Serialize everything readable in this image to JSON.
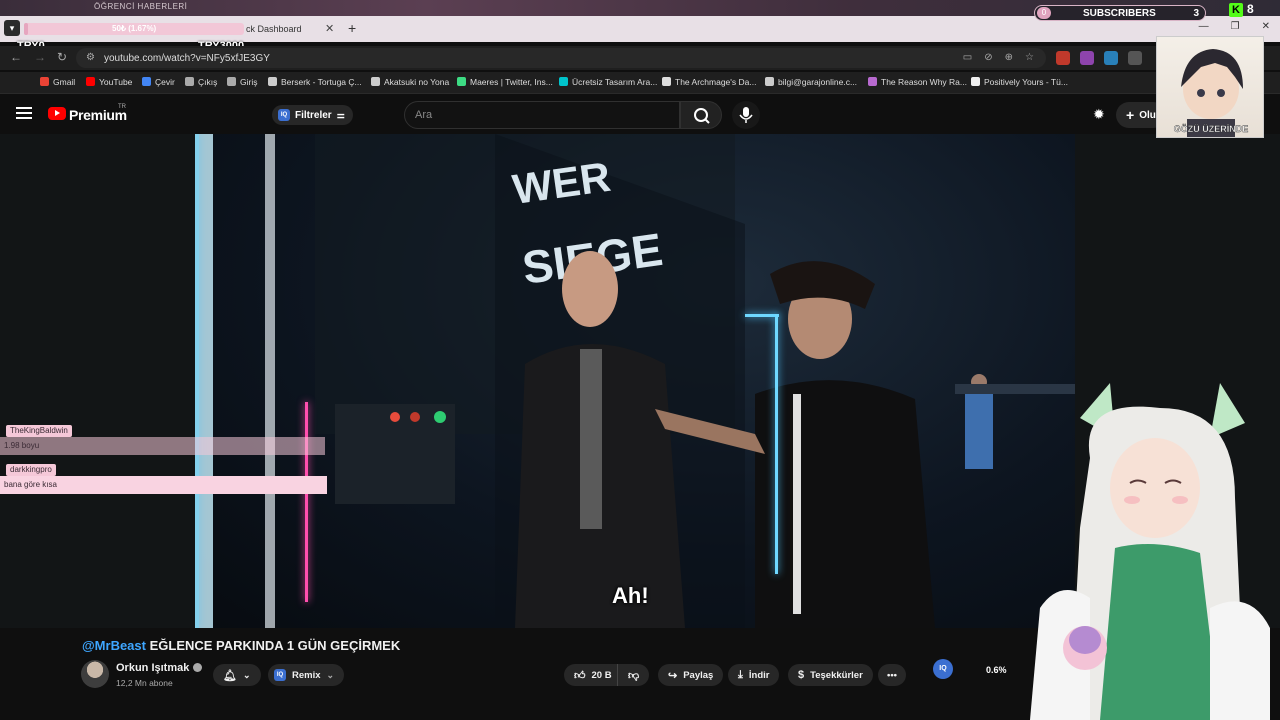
{
  "stream_overlay": {
    "ghost_title": "ÖĞRENCİ HABERLERİ",
    "progress_text": "50₺ (1.67%)",
    "progress_fraction": 0.0167,
    "try_left": "TRY0",
    "try_right": "TRY3000",
    "subscriber_widget": {
      "left_count": "0",
      "label": "SUBSCRIBERS",
      "right_count": "3"
    },
    "kick_badge": {
      "letter": "K",
      "count": "8"
    }
  },
  "browser": {
    "tab_title": "ck Dashboard",
    "url": "youtube.com/watch?v=NFy5xfJE3GY",
    "bookmarks": [
      {
        "label": "Gmail",
        "color": "#ea4335"
      },
      {
        "label": "YouTube",
        "color": "#ff0000"
      },
      {
        "label": "Çevir",
        "color": "#4285f4"
      },
      {
        "label": "Çıkış",
        "color": "#aaaaaa"
      },
      {
        "label": "Giriş",
        "color": "#aaaaaa"
      },
      {
        "label": "Berserk - Tortuga Ç...",
        "color": "#cccccc"
      },
      {
        "label": "Akatsuki no Yona",
        "color": "#cccccc"
      },
      {
        "label": "Maeres | Twitter, Ins...",
        "color": "#3ddc84"
      },
      {
        "label": "Ücretsiz Tasarım Ara...",
        "color": "#00c4cc"
      },
      {
        "label": "The Archmage's Da...",
        "color": "#dddddd"
      },
      {
        "label": "bilgi@garajonline.c...",
        "color": "#cccccc"
      },
      {
        "label": "The Reason Why Ra...",
        "color": "#b86ad0"
      },
      {
        "label": "Positively Yours - Tü...",
        "color": "#f0f0f0"
      }
    ]
  },
  "youtube": {
    "brand": "Premium",
    "region": "TR",
    "filters_label": "Filtreler",
    "search_placeholder": "Ara",
    "stats": {
      "views": "166",
      "eye": "0",
      "users": "1"
    },
    "create_label": "Olu",
    "subtitle": "Ah!",
    "video": {
      "hashtag": "@MrBeast",
      "title": " EĞLENCE PARKINDA 1 GÜN GEÇİRMEK",
      "channel": "Orkun Işıtmak",
      "subscribers": "12,2 Mn abone"
    },
    "actions": {
      "remix": "Remix",
      "likes": "20 B",
      "share": "Paylaş",
      "download": "İndir",
      "thanks": "Teşekkürler"
    },
    "side_percent": "0.6%"
  },
  "chat": [
    {
      "user": "TheKingBaldwin",
      "message": "1.98 boyu"
    },
    {
      "user": "darkkingpro",
      "message": "bana göre kısa"
    }
  ],
  "avatar_caption": "GÖZÜ ÜZERİNDE"
}
